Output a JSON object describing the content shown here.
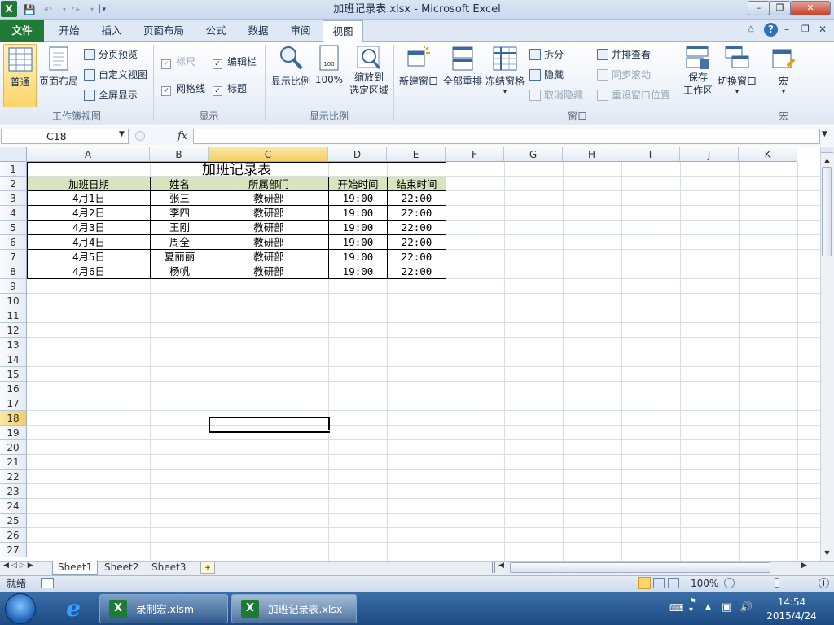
{
  "window": {
    "title": "加班记录表.xlsx - Microsoft Excel",
    "app_icon": "X"
  },
  "tabs": [
    {
      "label": "文件",
      "name": "tab-file"
    },
    {
      "label": "开始",
      "name": "tab-home"
    },
    {
      "label": "插入",
      "name": "tab-insert"
    },
    {
      "label": "页面布局",
      "name": "tab-page-layout"
    },
    {
      "label": "公式",
      "name": "tab-formulas"
    },
    {
      "label": "数据",
      "name": "tab-data"
    },
    {
      "label": "审阅",
      "name": "tab-review"
    },
    {
      "label": "视图",
      "name": "tab-view"
    }
  ],
  "ribbon": {
    "workbook_views": {
      "label": "工作簿视图",
      "normal": "普通",
      "page_layout": "页面布局",
      "page_break": "分页预览",
      "custom_views": "自定义视图",
      "full_screen": "全屏显示"
    },
    "show": {
      "label": "显示",
      "ruler": "标尺",
      "formula_bar": "编辑栏",
      "gridlines": "网格线",
      "headings": "标题"
    },
    "zoom": {
      "label": "显示比例",
      "zoom": "显示比例",
      "hundred": "100%",
      "zoom_selection_l1": "缩放到",
      "zoom_selection_l2": "选定区域"
    },
    "window": {
      "label": "窗口",
      "new_window": "新建窗口",
      "arrange_all": "全部重排",
      "freeze_panes": "冻结窗格",
      "split": "拆分",
      "hide": "隐藏",
      "unhide": "取消隐藏",
      "side_by_side": "并排查看",
      "sync_scroll": "同步滚动",
      "reset_position": "重设窗口位置",
      "save_workspace_l1": "保存",
      "save_workspace_l2": "工作区",
      "switch_windows": "切换窗口"
    },
    "macros": {
      "label": "宏",
      "macros": "宏"
    }
  },
  "formula_bar": {
    "name_box": "C18",
    "fx": "fx",
    "content": ""
  },
  "columns": [
    "A",
    "B",
    "C",
    "D",
    "E",
    "F",
    "G",
    "H",
    "I",
    "J",
    "K"
  ],
  "rows": [
    "1",
    "2",
    "3",
    "4",
    "5",
    "6",
    "7",
    "8",
    "9",
    "10",
    "11",
    "12",
    "13",
    "14",
    "15",
    "16",
    "17",
    "18",
    "19",
    "20",
    "21",
    "22",
    "23",
    "24",
    "25",
    "26",
    "27"
  ],
  "sheet": {
    "title": "加班记录表",
    "headers": [
      "加班日期",
      "姓名",
      "所属部门",
      "开始时间",
      "结束时间"
    ],
    "records": [
      [
        "4月1日",
        "张三",
        "教研部",
        "19:00",
        "22:00"
      ],
      [
        "4月2日",
        "李四",
        "教研部",
        "19:00",
        "22:00"
      ],
      [
        "4月3日",
        "王刚",
        "教研部",
        "19:00",
        "22:00"
      ],
      [
        "4月4日",
        "周全",
        "教研部",
        "19:00",
        "22:00"
      ],
      [
        "4月5日",
        "夏丽丽",
        "教研部",
        "19:00",
        "22:00"
      ],
      [
        "4月6日",
        "杨帆",
        "教研部",
        "19:00",
        "22:00"
      ]
    ]
  },
  "sheet_tabs": [
    "Sheet1",
    "Sheet2",
    "Sheet3"
  ],
  "status": {
    "ready": "就绪",
    "zoom": "100%"
  },
  "taskbar": {
    "items": [
      "录制宏.xlsm",
      "加班记录表.xlsx"
    ],
    "time": "14:54",
    "date": "2015/4/24"
  }
}
